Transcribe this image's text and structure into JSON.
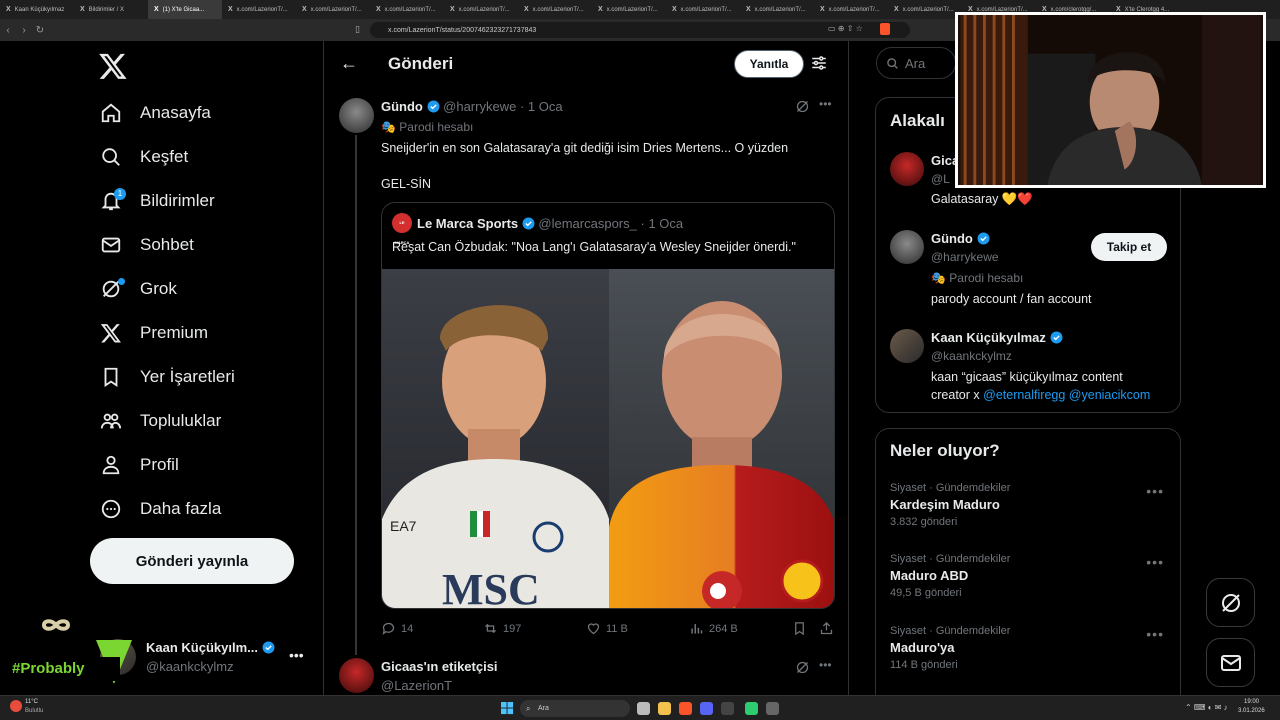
{
  "browser": {
    "tabs": [
      {
        "label": "Kaan Küçükyılmaz",
        "active": false
      },
      {
        "label": "Bildirimler / X",
        "active": false
      },
      {
        "label": "(1) X'te Gicaa...",
        "active": true
      },
      {
        "label": "x.com/LazerionT/...",
        "active": false
      },
      {
        "label": "x.com/LazerionT/...",
        "active": false
      },
      {
        "label": "x.com/LazerionT/...",
        "active": false
      },
      {
        "label": "x.com/LazerionT/...",
        "active": false
      },
      {
        "label": "x.com/LazerionT/...",
        "active": false
      },
      {
        "label": "x.com/LazerionT/...",
        "active": false
      },
      {
        "label": "x.com/LazerionT/...",
        "active": false
      },
      {
        "label": "x.com/LazerionT/...",
        "active": false
      },
      {
        "label": "x.com/LazerionT/...",
        "active": false
      },
      {
        "label": "x.com/LazerionT/...",
        "active": false
      },
      {
        "label": "x.com/LazerionT/...",
        "active": false
      },
      {
        "label": "x.com/clerotgg/...",
        "active": false
      },
      {
        "label": "X'te Clerotgg 4...",
        "active": false
      }
    ],
    "url": "x.com/LazerionT/status/2007462323271737843"
  },
  "sidebar": {
    "items": [
      {
        "label": "Anasayfa",
        "icon": "home-icon"
      },
      {
        "label": "Keşfet",
        "icon": "search-icon"
      },
      {
        "label": "Bildirimler",
        "icon": "bell-icon",
        "badge": "1"
      },
      {
        "label": "Sohbet",
        "icon": "mail-icon"
      },
      {
        "label": "Grok",
        "icon": "grok-icon"
      },
      {
        "label": "Premium",
        "icon": "x-icon"
      },
      {
        "label": "Yer İşaretleri",
        "icon": "bookmark-icon"
      },
      {
        "label": "Topluluklar",
        "icon": "communities-icon"
      },
      {
        "label": "Profil",
        "icon": "profile-icon"
      },
      {
        "label": "Daha fazla",
        "icon": "more-icon"
      }
    ],
    "post_button": "Gönderi yayınla",
    "account": {
      "name": "Kaan Küçükyılm...",
      "handle": "@kaankckylmz"
    }
  },
  "overlay_tag": "#Probably",
  "main": {
    "title": "Gönderi",
    "reply_button": "Yanıtla",
    "tweet": {
      "author": "Gündo",
      "handle": "@harrykewe",
      "date": "1 Oca",
      "parody_label": "Parodi hesabı",
      "text_line1": "Sneijder'in en son Galatasaray'a git dediği isim Dries Mertens... O yüzden",
      "text_line2": "GEL-SİN",
      "quote": {
        "author": "Le Marca Sports",
        "logo_text": "LE MARCA",
        "handle": "@lemarcaspors_",
        "date": "1 Oca",
        "text": "Reşat Can Özbudak: \"Noa Lang'ı Galatasaray'a Wesley Sneijder önerdi.\""
      },
      "actions": {
        "replies": "14",
        "reposts": "197",
        "likes": "11 B",
        "views": "264 B"
      }
    },
    "reply": {
      "author": "Gicaas'ın etiketçisi",
      "handle": "@LazerionT"
    }
  },
  "right": {
    "search_placeholder": "Ara",
    "related": {
      "title": "Alakalı",
      "people": [
        {
          "name": "Gica",
          "handle": "@L",
          "bio": "Galatasaray 💛❤️"
        },
        {
          "name": "Gündo",
          "handle": "@harrykewe",
          "parody": "Parodi hesabı",
          "bio": "parody account / fan account",
          "follow": "Takip et"
        },
        {
          "name": "Kaan Küçükyılmaz",
          "handle": "@kaankckylmz",
          "bio_line1": "kaan “gicaas” küçükyılmaz content",
          "bio_prefix": "creator x",
          "link1": "@eternalfiregg",
          "link2": "@yeniacikcom"
        }
      ]
    },
    "trends": {
      "title": "Neler oluyor?",
      "items": [
        {
          "meta": "Siyaset · Gündemdekiler",
          "name": "Kardeşim Maduro",
          "count": "3.832 gönderi"
        },
        {
          "meta": "Siyaset · Gündemdekiler",
          "name": "Maduro ABD",
          "count": "49,5 B gönderi"
        },
        {
          "meta": "Siyaset · Gündemdekiler",
          "name": "Maduro'ya",
          "count": "114 B gönderi"
        }
      ]
    }
  },
  "taskbar": {
    "weather_temp": "11°C",
    "weather_desc": "Bulutlu",
    "search": "Ara",
    "time": "19:00",
    "date": "3.01.2026"
  },
  "colors": {
    "accent": "#1d9bf0",
    "background": "#000000",
    "border": "#2f3336",
    "muted": "#71767b",
    "tag_green": "#7bd632"
  }
}
